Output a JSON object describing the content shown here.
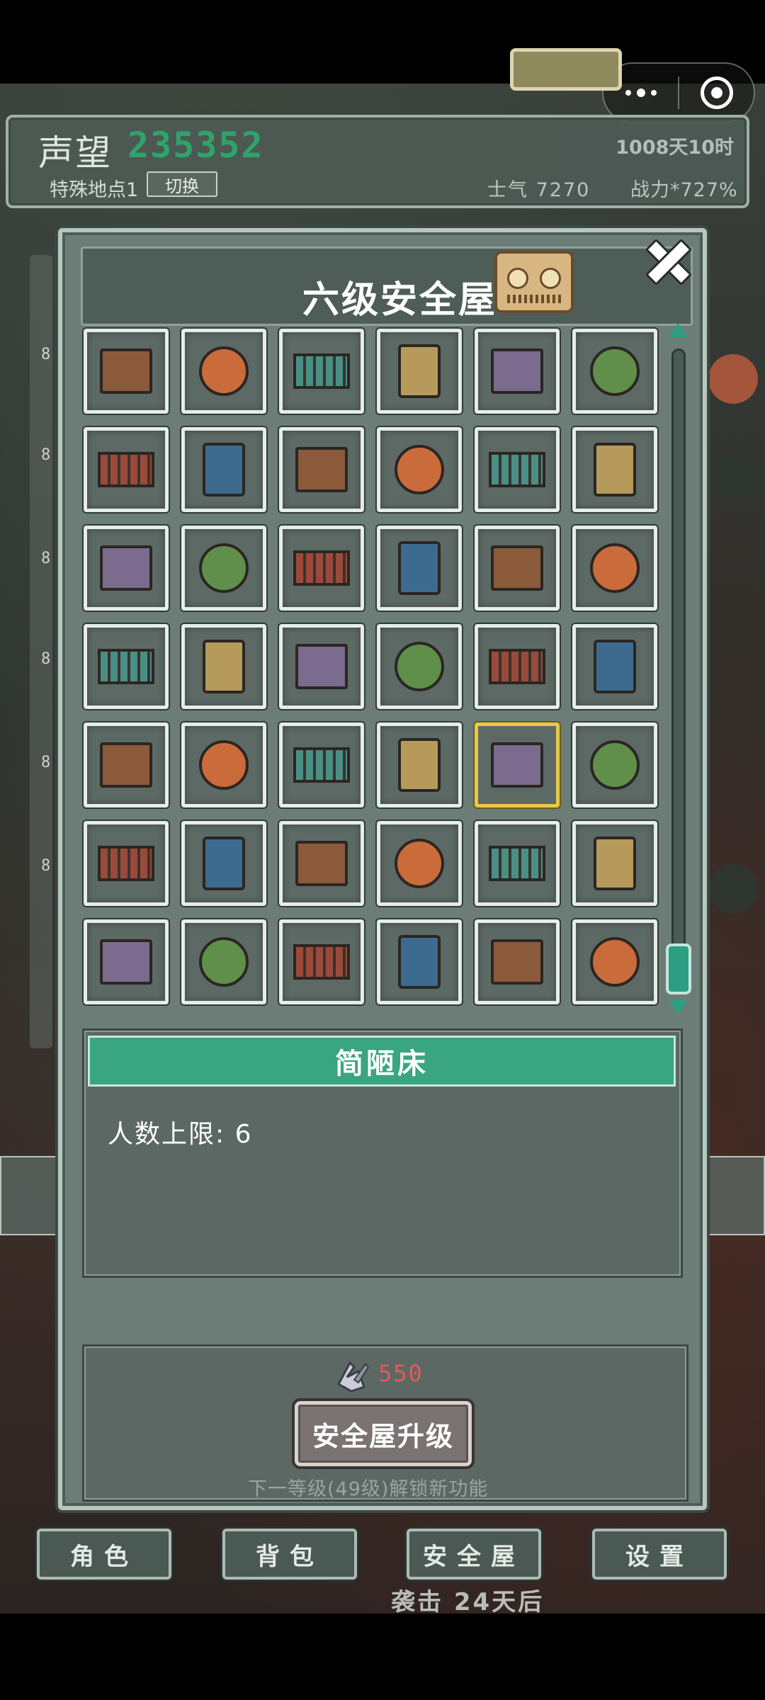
{
  "header": {
    "reputation_label": "声望",
    "reputation_value": "235352",
    "day_time": "1008天10时",
    "place_label": "特殊地点1",
    "switch_label": "切换",
    "morale": "士气 7270",
    "power": "战力*727%"
  },
  "panel": {
    "title": "六级安全屋",
    "close_icon": "close-icon"
  },
  "grid_items": [
    "kitchen-layout-icon",
    "wooden-table-icon",
    "brown-rug-icon",
    "teal-mat-icon",
    "rusty-bench-icon",
    "garden-planter-icon",
    "kitchen-counter-icon",
    "basketball-icon",
    "air-vent-icon",
    "pink-bed-icon",
    "workbench-machine-icon",
    "dining-table-icon",
    "pool-table-icon",
    "radio-icon",
    "yellow-blanket-icon",
    "crafting-station-icon",
    "round-rug-icon",
    "piano-icon",
    "aquarium-desk-icon",
    "purple-cushion-icon",
    "round-table-icon",
    "tv-cabinet-icon",
    "floor-grate-icon",
    "double-bed-icon",
    "generator-machine-icon",
    "teal-workdesk-icon",
    "character-figure-icon",
    "bookshelf-icon",
    "simple-bed-icon",
    "lab-counter-icon",
    "round-dining-icon",
    "game-controller-icon",
    "wooden-shelf-icon",
    "sofa-set-icon",
    "planter-box-icon",
    "teal-desk-icon",
    "retro-tv-icon",
    "display-crate-icon",
    "canopy-bed-icon",
    "stove-counter-icon",
    "purple-kitchen-icon",
    "long-dining-icon"
  ],
  "selected_index": 28,
  "detail": {
    "name": "简陋床",
    "capacity_text": "人数上限: 6"
  },
  "upgrade": {
    "cost": "550",
    "button_label": "安全屋升级",
    "hint": "下一等级(49级)解锁新功能"
  },
  "nav": {
    "role": "角色",
    "bag": "背包",
    "safehouse": "安全屋",
    "settings": "设置"
  },
  "raid_text": "袭击 24天后",
  "colors": {
    "accent_green": "#3aa581",
    "reputation_green": "#2fa36a",
    "cost_red": "#e65a5a",
    "selected_gold": "#e8c84a"
  }
}
